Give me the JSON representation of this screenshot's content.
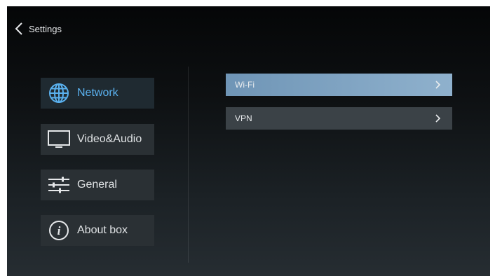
{
  "header": {
    "title": "Settings",
    "back_icon": "chevron-left-icon"
  },
  "menu": {
    "items": [
      {
        "label": "Network",
        "icon": "globe-icon",
        "active": true
      },
      {
        "label": "Video&Audio",
        "icon": "monitor-icon",
        "active": false
      },
      {
        "label": "General",
        "icon": "sliders-icon",
        "active": false
      },
      {
        "label": "About box",
        "icon": "info-icon",
        "active": false
      }
    ]
  },
  "content": {
    "items": [
      {
        "label": "Wi-Fi",
        "icon": "chevron-right-icon",
        "focused": true
      },
      {
        "label": "VPN",
        "icon": "chevron-right-icon",
        "focused": false
      }
    ]
  },
  "colors": {
    "accent": "#5ab1ef",
    "focus_bar": "#7fa4c4",
    "panel": "#2a3034",
    "text": "#dfe2e4"
  }
}
